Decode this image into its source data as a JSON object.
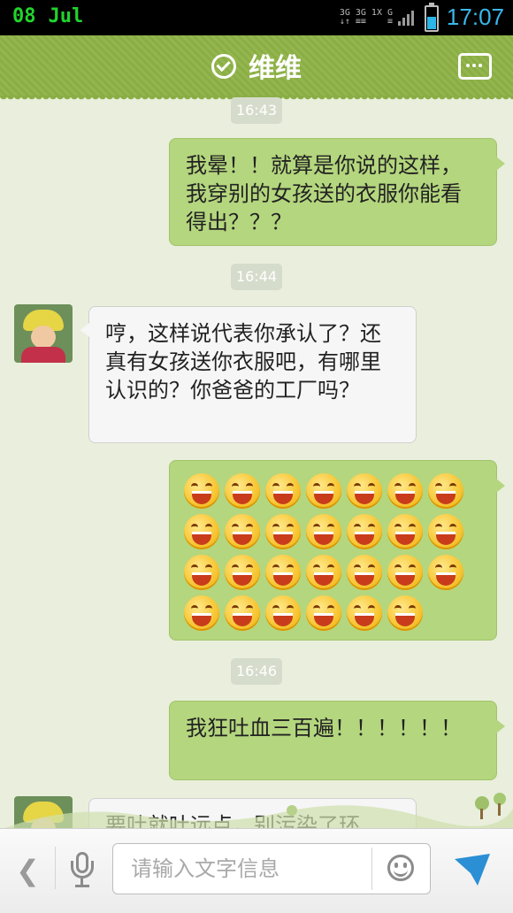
{
  "status_bar": {
    "day": "08",
    "month": "Jul",
    "time": "17:07",
    "net1": "3G",
    "net2": "3G 1X",
    "signal": "G"
  },
  "header": {
    "title": "维维"
  },
  "timestamps": [
    "16:43",
    "16:44",
    "16:46"
  ],
  "messages": [
    {
      "side": "sent",
      "text": "我晕！！就算是你说的这样，我穿别的女孩送的衣服你能看得出？？？"
    },
    {
      "side": "received",
      "text": "哼，这样说代表你承认了？还真有女孩送你衣服吧，有哪里认识的？你爸爸的工厂吗？"
    },
    {
      "side": "sent",
      "type": "emoji",
      "emoji": "laughing-face",
      "count": 27
    },
    {
      "side": "sent",
      "text": "我狂吐血三百遍！！！！！！"
    },
    {
      "side": "received",
      "text": "要吐就吐远点，别污染了环"
    }
  ],
  "input": {
    "placeholder": "请输入文字信息"
  },
  "colors": {
    "header": "#8aae45",
    "sent_bubble": "#b4d67e",
    "received_bubble": "#f6f6f6",
    "background": "#e9efdc",
    "time": "#39b8ea",
    "send": "#2a8fd4"
  }
}
